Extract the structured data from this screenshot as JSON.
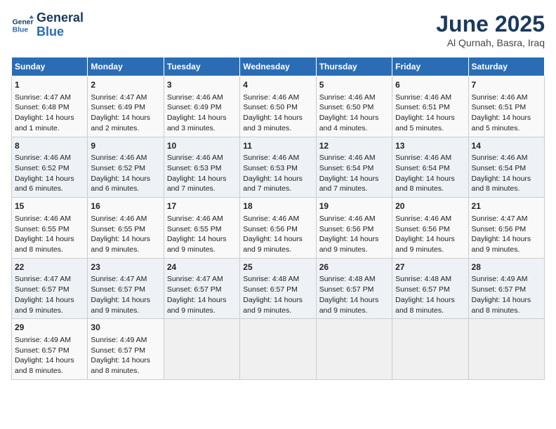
{
  "header": {
    "logo_line1": "General",
    "logo_line2": "Blue",
    "month": "June 2025",
    "location": "Al Qurnah, Basra, Iraq"
  },
  "days_of_week": [
    "Sunday",
    "Monday",
    "Tuesday",
    "Wednesday",
    "Thursday",
    "Friday",
    "Saturday"
  ],
  "weeks": [
    [
      {
        "day": "1",
        "info": "Sunrise: 4:47 AM\nSunset: 6:48 PM\nDaylight: 14 hours and 1 minute."
      },
      {
        "day": "2",
        "info": "Sunrise: 4:47 AM\nSunset: 6:49 PM\nDaylight: 14 hours and 2 minutes."
      },
      {
        "day": "3",
        "info": "Sunrise: 4:46 AM\nSunset: 6:49 PM\nDaylight: 14 hours and 3 minutes."
      },
      {
        "day": "4",
        "info": "Sunrise: 4:46 AM\nSunset: 6:50 PM\nDaylight: 14 hours and 3 minutes."
      },
      {
        "day": "5",
        "info": "Sunrise: 4:46 AM\nSunset: 6:50 PM\nDaylight: 14 hours and 4 minutes."
      },
      {
        "day": "6",
        "info": "Sunrise: 4:46 AM\nSunset: 6:51 PM\nDaylight: 14 hours and 5 minutes."
      },
      {
        "day": "7",
        "info": "Sunrise: 4:46 AM\nSunset: 6:51 PM\nDaylight: 14 hours and 5 minutes."
      }
    ],
    [
      {
        "day": "8",
        "info": "Sunrise: 4:46 AM\nSunset: 6:52 PM\nDaylight: 14 hours and 6 minutes."
      },
      {
        "day": "9",
        "info": "Sunrise: 4:46 AM\nSunset: 6:52 PM\nDaylight: 14 hours and 6 minutes."
      },
      {
        "day": "10",
        "info": "Sunrise: 4:46 AM\nSunset: 6:53 PM\nDaylight: 14 hours and 7 minutes."
      },
      {
        "day": "11",
        "info": "Sunrise: 4:46 AM\nSunset: 6:53 PM\nDaylight: 14 hours and 7 minutes."
      },
      {
        "day": "12",
        "info": "Sunrise: 4:46 AM\nSunset: 6:54 PM\nDaylight: 14 hours and 7 minutes."
      },
      {
        "day": "13",
        "info": "Sunrise: 4:46 AM\nSunset: 6:54 PM\nDaylight: 14 hours and 8 minutes."
      },
      {
        "day": "14",
        "info": "Sunrise: 4:46 AM\nSunset: 6:54 PM\nDaylight: 14 hours and 8 minutes."
      }
    ],
    [
      {
        "day": "15",
        "info": "Sunrise: 4:46 AM\nSunset: 6:55 PM\nDaylight: 14 hours and 8 minutes."
      },
      {
        "day": "16",
        "info": "Sunrise: 4:46 AM\nSunset: 6:55 PM\nDaylight: 14 hours and 9 minutes."
      },
      {
        "day": "17",
        "info": "Sunrise: 4:46 AM\nSunset: 6:55 PM\nDaylight: 14 hours and 9 minutes."
      },
      {
        "day": "18",
        "info": "Sunrise: 4:46 AM\nSunset: 6:56 PM\nDaylight: 14 hours and 9 minutes."
      },
      {
        "day": "19",
        "info": "Sunrise: 4:46 AM\nSunset: 6:56 PM\nDaylight: 14 hours and 9 minutes."
      },
      {
        "day": "20",
        "info": "Sunrise: 4:46 AM\nSunset: 6:56 PM\nDaylight: 14 hours and 9 minutes."
      },
      {
        "day": "21",
        "info": "Sunrise: 4:47 AM\nSunset: 6:56 PM\nDaylight: 14 hours and 9 minutes."
      }
    ],
    [
      {
        "day": "22",
        "info": "Sunrise: 4:47 AM\nSunset: 6:57 PM\nDaylight: 14 hours and 9 minutes."
      },
      {
        "day": "23",
        "info": "Sunrise: 4:47 AM\nSunset: 6:57 PM\nDaylight: 14 hours and 9 minutes."
      },
      {
        "day": "24",
        "info": "Sunrise: 4:47 AM\nSunset: 6:57 PM\nDaylight: 14 hours and 9 minutes."
      },
      {
        "day": "25",
        "info": "Sunrise: 4:48 AM\nSunset: 6:57 PM\nDaylight: 14 hours and 9 minutes."
      },
      {
        "day": "26",
        "info": "Sunrise: 4:48 AM\nSunset: 6:57 PM\nDaylight: 14 hours and 9 minutes."
      },
      {
        "day": "27",
        "info": "Sunrise: 4:48 AM\nSunset: 6:57 PM\nDaylight: 14 hours and 8 minutes."
      },
      {
        "day": "28",
        "info": "Sunrise: 4:49 AM\nSunset: 6:57 PM\nDaylight: 14 hours and 8 minutes."
      }
    ],
    [
      {
        "day": "29",
        "info": "Sunrise: 4:49 AM\nSunset: 6:57 PM\nDaylight: 14 hours and 8 minutes."
      },
      {
        "day": "30",
        "info": "Sunrise: 4:49 AM\nSunset: 6:57 PM\nDaylight: 14 hours and 8 minutes."
      },
      {
        "day": "",
        "info": ""
      },
      {
        "day": "",
        "info": ""
      },
      {
        "day": "",
        "info": ""
      },
      {
        "day": "",
        "info": ""
      },
      {
        "day": "",
        "info": ""
      }
    ]
  ]
}
